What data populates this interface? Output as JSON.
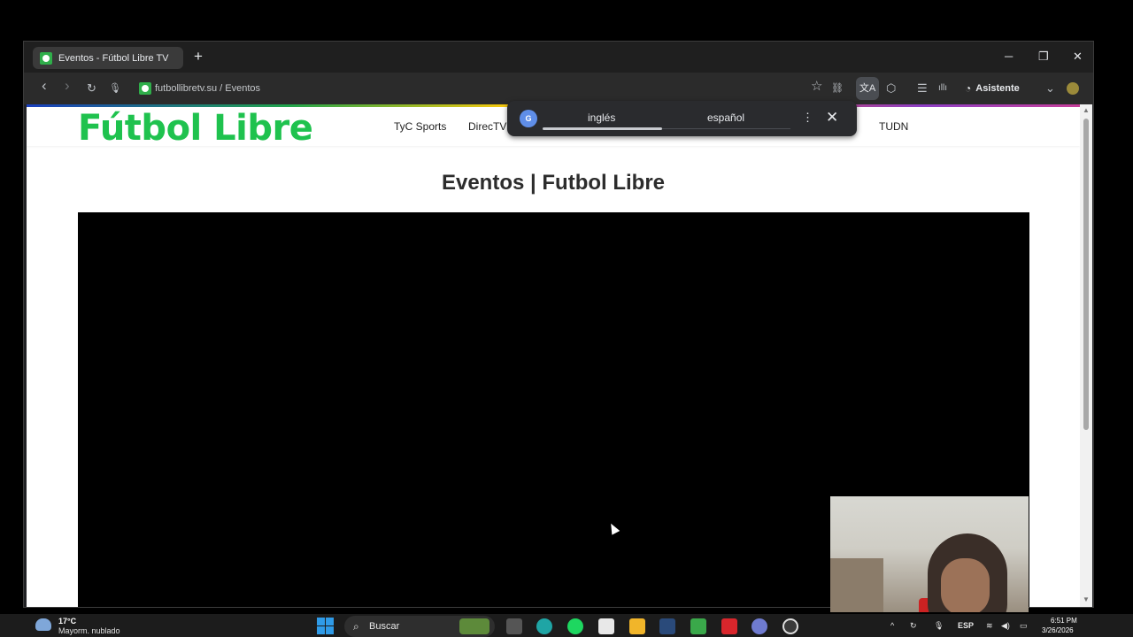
{
  "browser": {
    "tab_title": "Eventos - Fútbol Libre TV",
    "new_tab": "+",
    "minimize": "─",
    "restore": "❐",
    "close": "✕",
    "back": "‹",
    "forward": "›",
    "reload": "↻",
    "mic": "🎙",
    "url": "futbollibretv.su / Eventos",
    "star": "☆",
    "link": "⛓",
    "translate": "文A",
    "extensions": "⬡",
    "reading": "☰",
    "media": "ıllı",
    "assistant_label": "Asistente",
    "assistant_icon": "◔",
    "expand": "⌄"
  },
  "site": {
    "logo": "Fútbol Libre",
    "nav": [
      "TyC Sports",
      "DirecTV",
      "TUDN"
    ],
    "page_title": "Eventos | Futbol Libre"
  },
  "translate_popup": {
    "icon": "G",
    "source_lang": "inglés",
    "target_lang": "español",
    "menu": "⋮",
    "close": "✕"
  },
  "taskbar": {
    "weather_temp": "17°C",
    "weather_desc": "Mayorm. nublado",
    "search_placeholder": "Buscar",
    "search_icon": "⌕",
    "language": "ESP",
    "time": "6:51 PM",
    "date": "3/26/2026",
    "tray_chevron": "^"
  },
  "colors": {
    "logo_green": "#1fc24e",
    "browser_dark": "#202124",
    "taskbar": "#1c1c1c"
  }
}
